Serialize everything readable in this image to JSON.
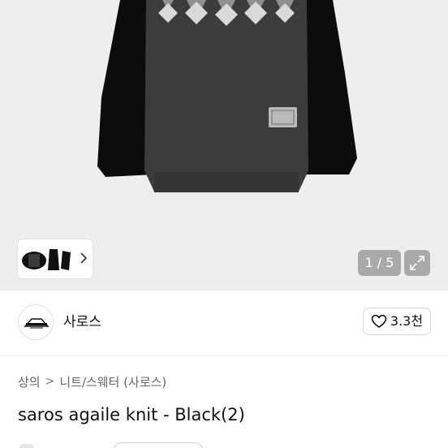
{
  "gallery": {
    "counter": "1 / 5",
    "current_image": 1,
    "total_images": 5,
    "thumbnail_count": 3
  },
  "icons": {
    "expand": "expand-arrows-icon",
    "next": "chevron-right-icon",
    "like": "heart-outline-icon",
    "breadcrumb_sep": "chevron-right-icon"
  },
  "shop": {
    "name": "사로스",
    "like_count": "3.3천"
  },
  "breadcrumb": {
    "items": [
      "상의",
      "니트/스웨터 (사로스)"
    ],
    "separator": ">"
  },
  "product": {
    "title": "saros agaile knit - Black(2)"
  },
  "colors": {
    "gallery_bg": "#eeeeef",
    "overlay_button": "#a9a9ab",
    "text_primary": "#111111",
    "text_secondary": "#666666"
  }
}
